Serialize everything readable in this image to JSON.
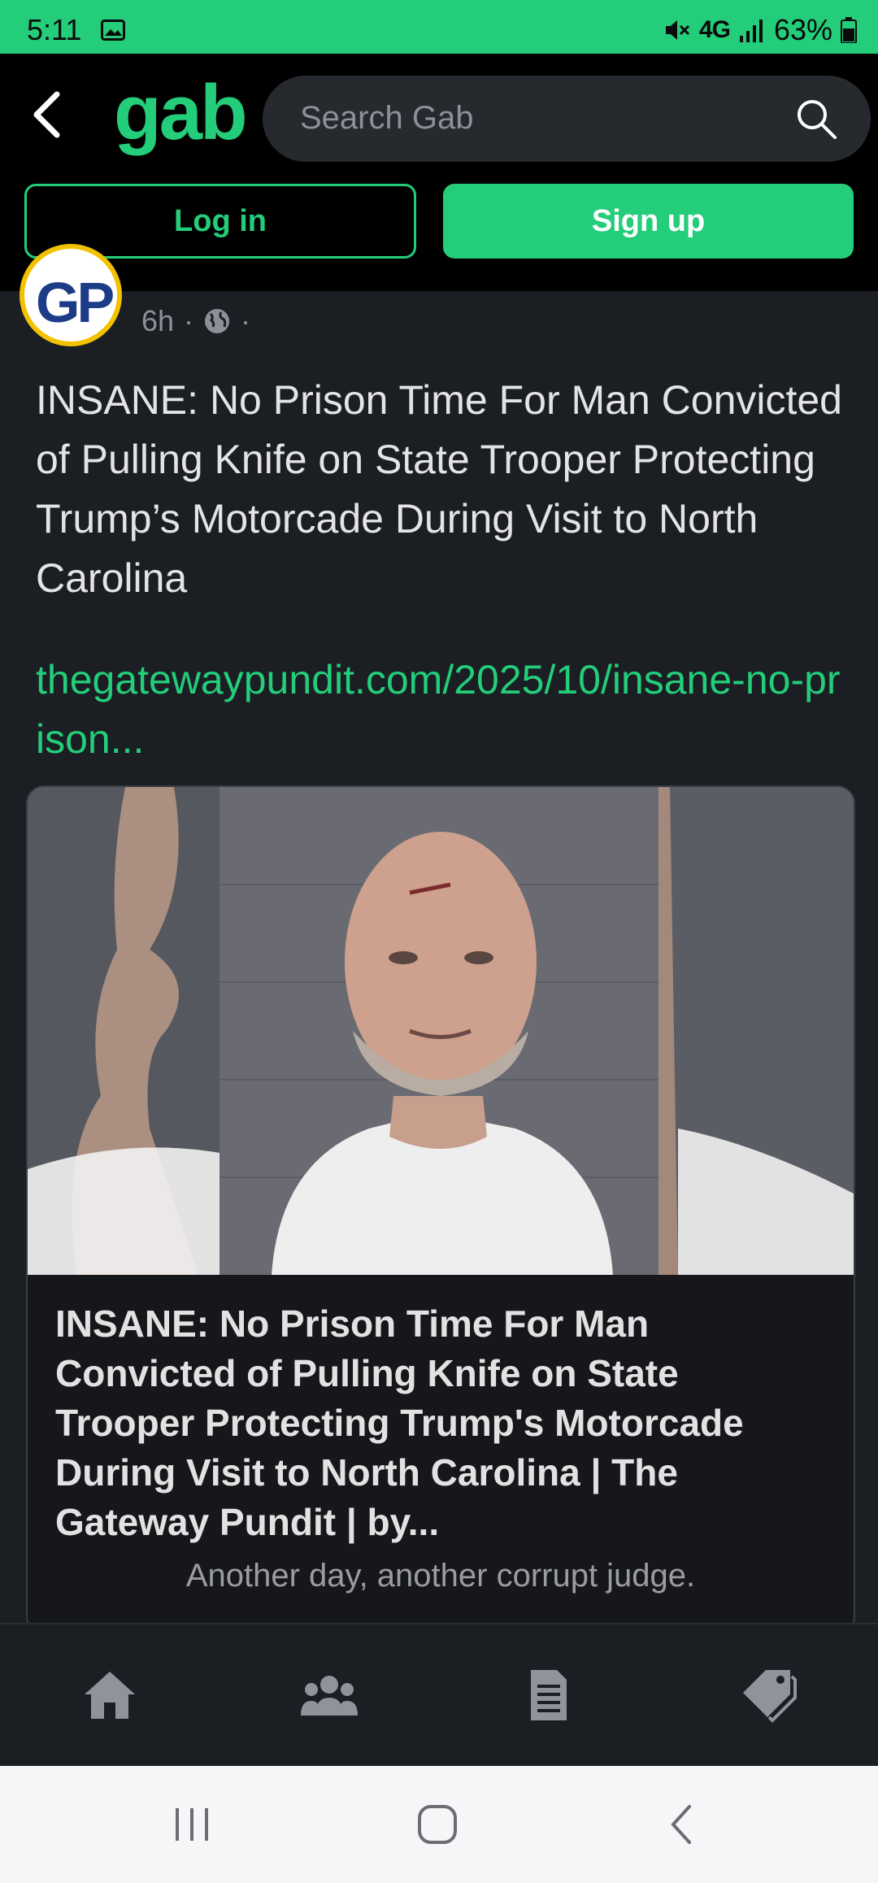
{
  "status_bar": {
    "time": "5:11",
    "network": "4G",
    "battery": "63%"
  },
  "header": {
    "logo": "gab",
    "search_placeholder": "Search Gab",
    "login_label": "Log in",
    "signup_label": "Sign up"
  },
  "post": {
    "avatar_initials": "GP",
    "time": "6h",
    "separator": "·",
    "text": "INSANE: No Prison Time For Man Convicted of Pulling Knife on State Trooper Protecting Trump’s Motorcade During Visit to North Carolina",
    "link": "thegatewaypundit.com/2025/10/insane-no-prison..."
  },
  "card": {
    "title": "INSANE: No Prison Time For Man Convicted of Pulling Knife on State Trooper Protecting Trump's Motorcade During Visit to North Carolina | The Gateway Pundit | by...",
    "description": "Another day, another corrupt judge."
  },
  "bottom_nav": {
    "items": [
      {
        "icon": "home-icon"
      },
      {
        "icon": "groups-icon"
      },
      {
        "icon": "news-icon"
      },
      {
        "icon": "tag-icon"
      }
    ]
  },
  "colors": {
    "accent": "#23cd7a",
    "background": "#1b1e23",
    "header": "#000000"
  }
}
